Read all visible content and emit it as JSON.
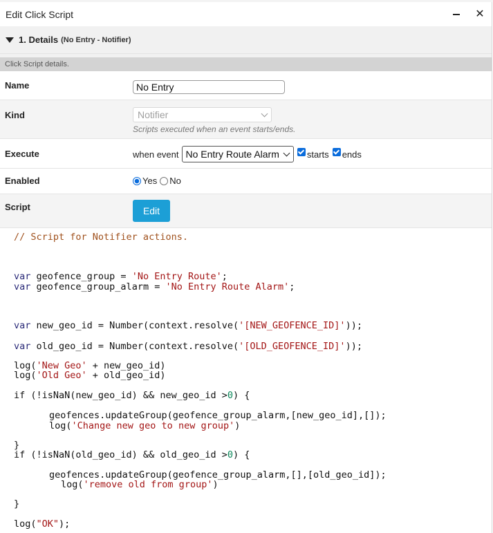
{
  "window": {
    "title": "Edit Click Script",
    "minimize_label": "minimize",
    "close_glyph": "✕"
  },
  "section": {
    "title": "1. Details",
    "subtitle": "(No Entry - Notifier)",
    "description": "Click Script details."
  },
  "form": {
    "name": {
      "label": "Name",
      "value": "No Entry"
    },
    "kind": {
      "label": "Kind",
      "value": "Notifier",
      "hint": "Scripts executed when an event starts/ends."
    },
    "execute": {
      "label": "Execute",
      "prefix": "when event",
      "event_value": "No Entry Route Alarm",
      "starts_label": "starts",
      "starts_checked": true,
      "ends_label": "ends",
      "ends_checked": true
    },
    "enabled": {
      "label": "Enabled",
      "yes_label": "Yes",
      "no_label": "No",
      "selected": "Yes"
    },
    "script": {
      "label": "Script",
      "edit_label": "Edit"
    }
  },
  "code": {
    "comment": "// Script for Notifier actions.",
    "var_kw": "var",
    "line_group": {
      "name": " geofence_group = ",
      "value": "'No Entry Route'",
      "end": ";"
    },
    "line_group_alarm": {
      "name": " geofence_group_alarm = ",
      "value": "'No Entry Route Alarm'",
      "end": ";"
    },
    "line_new_id": {
      "name": " new_geo_id = Number(context.resolve(",
      "value": "'[NEW_GEOFENCE_ID]'",
      "end": "));"
    },
    "line_old_id": {
      "name": " old_geo_id = Number(context.resolve(",
      "value": "'[OLD_GEOFENCE_ID]'",
      "end": "));"
    },
    "log_new": {
      "start": "log(",
      "value": "'New Geo'",
      "end": " + new_geo_id)"
    },
    "log_old": {
      "start": "log(",
      "value": "'Old Geo'",
      "end": " + old_geo_id)"
    },
    "if_new": {
      "start": "if (!isNaN(new_geo_id) && new_geo_id >",
      "num": "0",
      "end": ") {"
    },
    "update_new": "geofences.updateGroup(geofence_group_alarm,[new_geo_id],[]);",
    "log_change": {
      "start": "log(",
      "value": "'Change new geo to new group'",
      "end": ")"
    },
    "close_brace": "}",
    "if_old": {
      "start": "if (!isNaN(old_geo_id) && old_geo_id >",
      "num": "0",
      "end": ") {"
    },
    "update_old": "geofences.updateGroup(geofence_group_alarm,[],[old_geo_id]);",
    "log_remove": {
      "start": "log(",
      "value": "'remove old from group'",
      "end": ")"
    },
    "close_brace2": "}",
    "log_ok": {
      "start": "log(",
      "value": "\"OK\"",
      "end": ");"
    }
  }
}
